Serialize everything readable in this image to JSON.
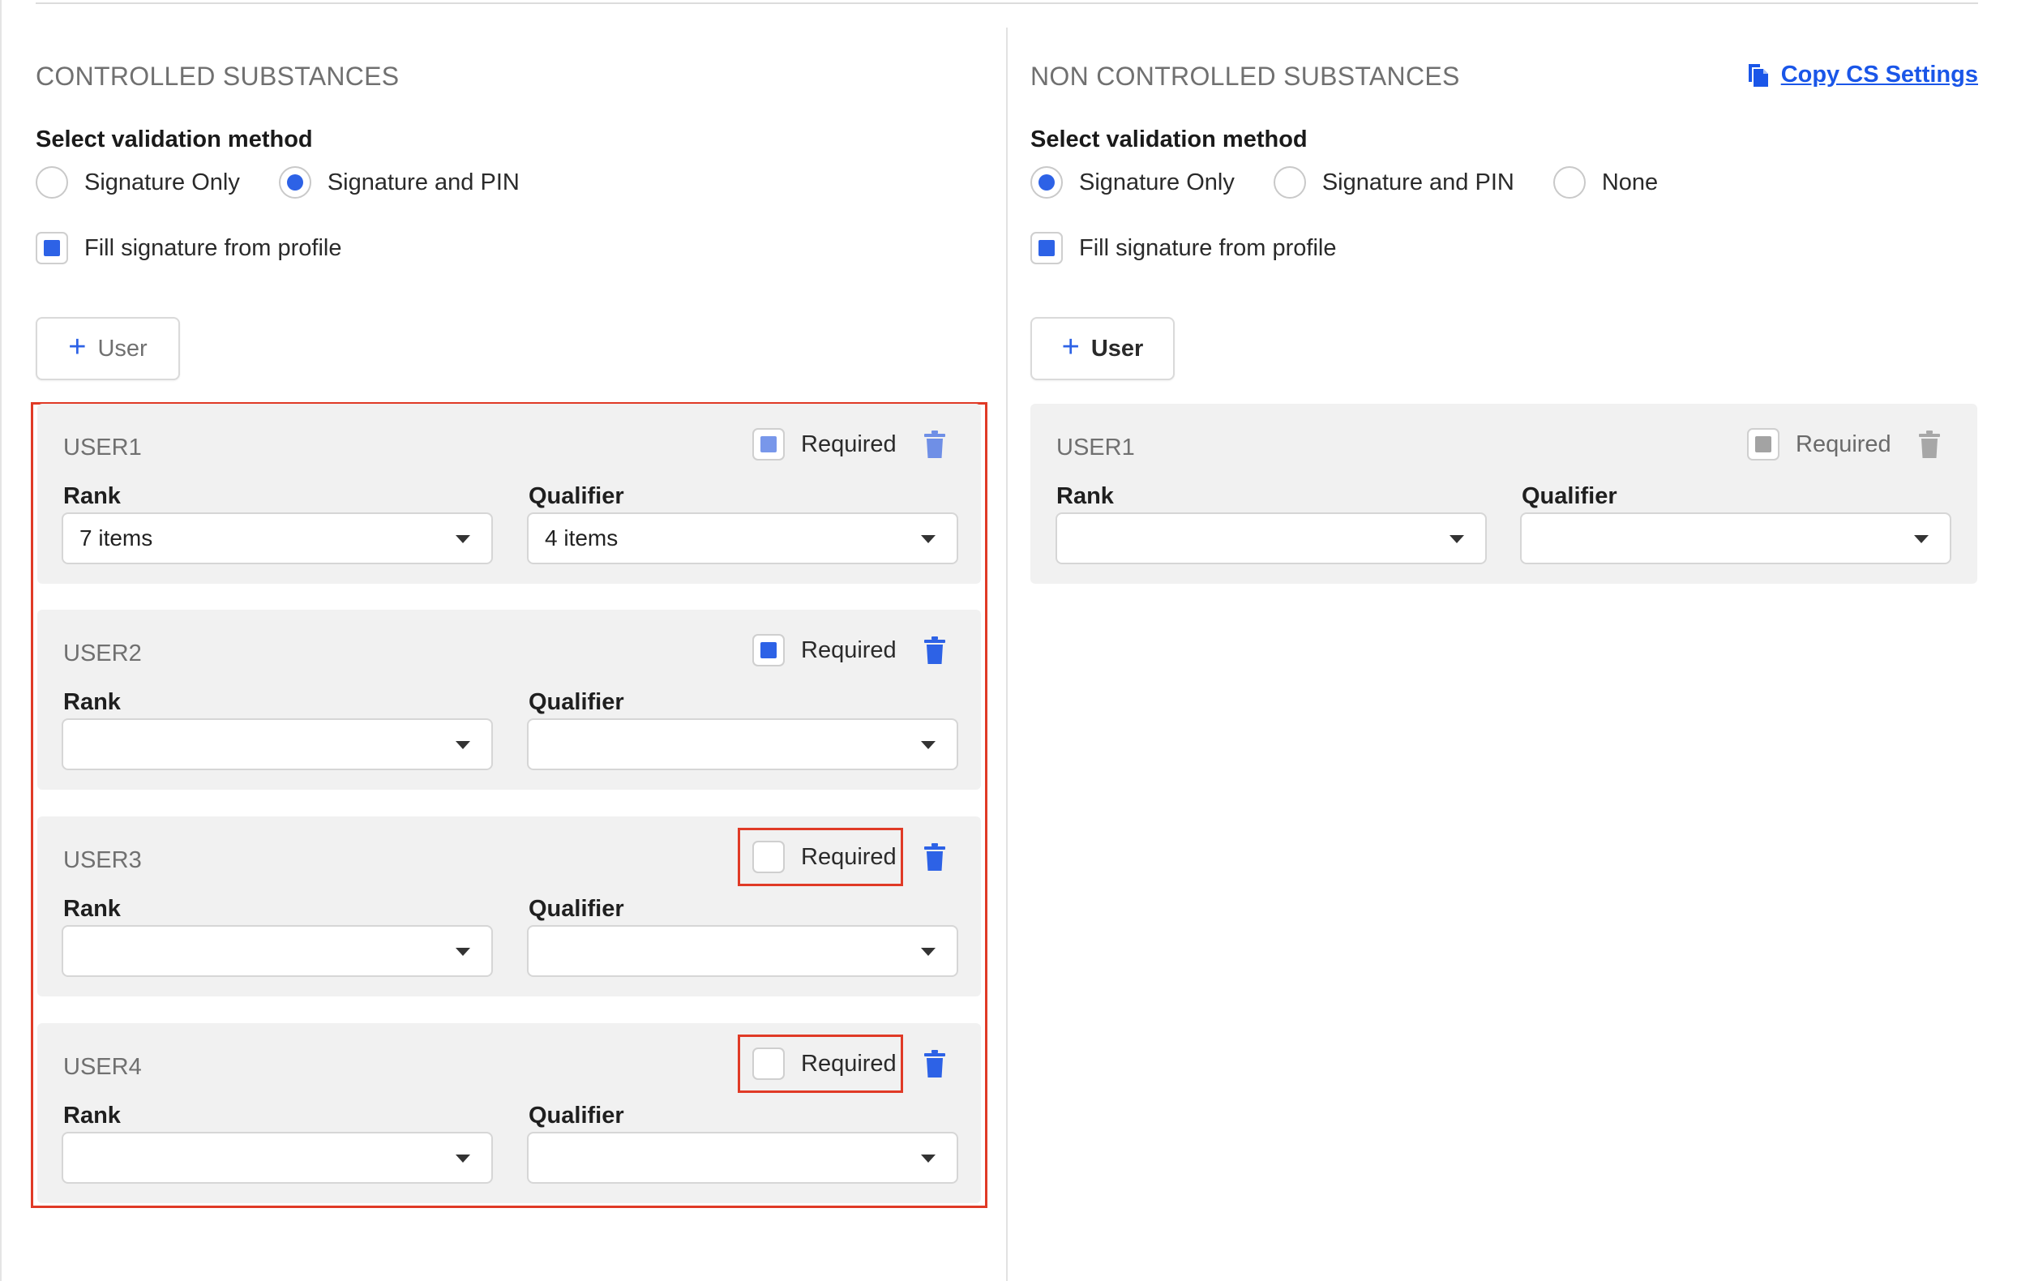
{
  "colors": {
    "accent": "#2d62e6",
    "highlight": "#e03a26",
    "link": "#1a56e8",
    "card_bg": "#f1f1f1"
  },
  "controlled": {
    "title": "CONTROLLED SUBSTANCES",
    "method_label": "Select validation method",
    "options": [
      {
        "label": "Signature Only",
        "selected": false
      },
      {
        "label": "Signature and PIN",
        "selected": true
      }
    ],
    "fill_signature": {
      "label": "Fill signature from profile",
      "checked": true
    },
    "add_user_label": "User",
    "users": [
      {
        "name": "USER1",
        "required_label": "Required",
        "required": true,
        "rank_label": "Rank",
        "rank_value": "7 items",
        "qualifier_label": "Qualifier",
        "qualifier_value": "4 items"
      },
      {
        "name": "USER2",
        "required_label": "Required",
        "required": true,
        "rank_label": "Rank",
        "rank_value": "",
        "qualifier_label": "Qualifier",
        "qualifier_value": ""
      },
      {
        "name": "USER3",
        "required_label": "Required",
        "required": false,
        "rank_label": "Rank",
        "rank_value": "",
        "qualifier_label": "Qualifier",
        "qualifier_value": ""
      },
      {
        "name": "USER4",
        "required_label": "Required",
        "required": false,
        "rank_label": "Rank",
        "rank_value": "",
        "qualifier_label": "Qualifier",
        "qualifier_value": ""
      }
    ]
  },
  "non_controlled": {
    "title": "NON CONTROLLED SUBSTANCES",
    "copy_link": "Copy CS Settings",
    "method_label": "Select validation method",
    "options": [
      {
        "label": "Signature Only",
        "selected": true
      },
      {
        "label": "Signature and PIN",
        "selected": false
      },
      {
        "label": "None",
        "selected": false
      }
    ],
    "fill_signature": {
      "label": "Fill signature from profile",
      "checked": true
    },
    "add_user_label": "User",
    "users": [
      {
        "name": "USER1",
        "required_label": "Required",
        "required": true,
        "disabled": true,
        "rank_label": "Rank",
        "rank_value": "",
        "qualifier_label": "Qualifier",
        "qualifier_value": ""
      }
    ]
  },
  "icons": {
    "copy": "copy-icon",
    "plus": "plus-icon",
    "trash": "trash-icon",
    "caret": "caret-down-icon"
  }
}
